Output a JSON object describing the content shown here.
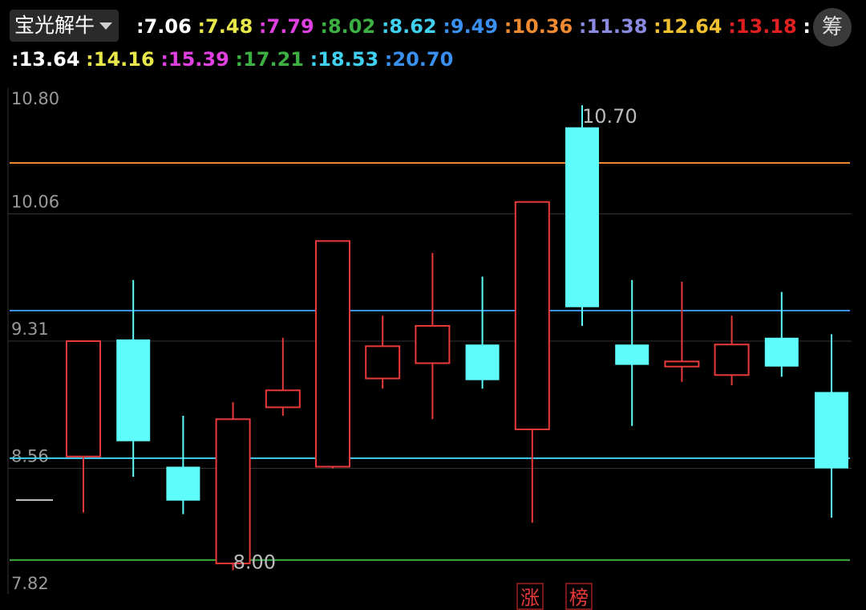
{
  "header": {
    "indicator_name": "宝光解牛",
    "levels": [
      {
        "value": "7.06",
        "color": "#ffffff"
      },
      {
        "value": "7.48",
        "color": "#e8e84a"
      },
      {
        "value": "7.79",
        "color": "#e040e0"
      },
      {
        "value": "8.02",
        "color": "#3cb043"
      },
      {
        "value": "8.62",
        "color": "#40d0f0"
      },
      {
        "value": "9.49",
        "color": "#3a90f0"
      },
      {
        "value": "10.36",
        "color": "#f08a30"
      },
      {
        "value": "11.38",
        "color": "#8a8ae0"
      },
      {
        "value": "12.64",
        "color": "#f0c030"
      },
      {
        "value": "13.18",
        "color": "#e02020"
      },
      {
        "value": "13.64",
        "color": "#ffffff"
      },
      {
        "value": "14.16",
        "color": "#e8e84a"
      },
      {
        "value": "15.39",
        "color": "#e040e0"
      },
      {
        "value": "17.21",
        "color": "#3cb043"
      },
      {
        "value": "18.53",
        "color": "#40d0f0"
      },
      {
        "value": "20.70",
        "color": "#3a90f0"
      }
    ],
    "chip_button": "筹"
  },
  "chart_data": {
    "type": "candlestick",
    "y_ticks": [
      "10.80",
      "10.06",
      "9.31",
      "8.56",
      "7.82"
    ],
    "ylim": [
      7.82,
      10.8
    ],
    "up_color": "#e83a3a",
    "down_color": "#5ffcfc",
    "candles": [
      {
        "open": 8.63,
        "close": 9.31,
        "high": 9.31,
        "low": 8.3
      },
      {
        "open": 9.32,
        "close": 8.72,
        "high": 9.67,
        "low": 8.51
      },
      {
        "open": 8.57,
        "close": 8.37,
        "high": 8.87,
        "low": 8.29
      },
      {
        "open": 8.0,
        "close": 8.85,
        "high": 8.95,
        "low": 7.96
      },
      {
        "open": 8.92,
        "close": 9.02,
        "high": 9.33,
        "low": 8.87
      },
      {
        "open": 8.57,
        "close": 9.9,
        "high": 9.9,
        "low": 8.56
      },
      {
        "open": 9.09,
        "close": 9.28,
        "high": 9.46,
        "low": 9.03
      },
      {
        "open": 9.18,
        "close": 9.4,
        "high": 9.83,
        "low": 8.85
      },
      {
        "open": 9.29,
        "close": 9.08,
        "high": 9.69,
        "low": 9.03
      },
      {
        "open": 8.79,
        "close": 10.13,
        "high": 10.13,
        "low": 8.24
      },
      {
        "open": 10.57,
        "close": 9.51,
        "high": 10.7,
        "low": 9.4
      },
      {
        "open": 9.29,
        "close": 9.17,
        "high": 9.67,
        "low": 8.81
      },
      {
        "open": 9.16,
        "close": 9.19,
        "high": 9.66,
        "low": 9.07
      },
      {
        "open": 9.11,
        "close": 9.29,
        "high": 9.46,
        "low": 9.05
      },
      {
        "open": 9.33,
        "close": 9.16,
        "high": 9.6,
        "low": 9.1
      },
      {
        "open": 9.01,
        "close": 8.56,
        "high": 9.35,
        "low": 8.27
      }
    ],
    "reference_lines": [
      {
        "value": 10.36,
        "color": "#f08a30"
      },
      {
        "value": 9.49,
        "color": "#3a90f0"
      },
      {
        "value": 8.62,
        "color": "#40d0f0"
      },
      {
        "value": 8.02,
        "color": "#3cb043"
      }
    ],
    "high_label": "10.70",
    "low_label": "8.00",
    "bottom_tags": [
      "涨",
      "榜"
    ]
  }
}
